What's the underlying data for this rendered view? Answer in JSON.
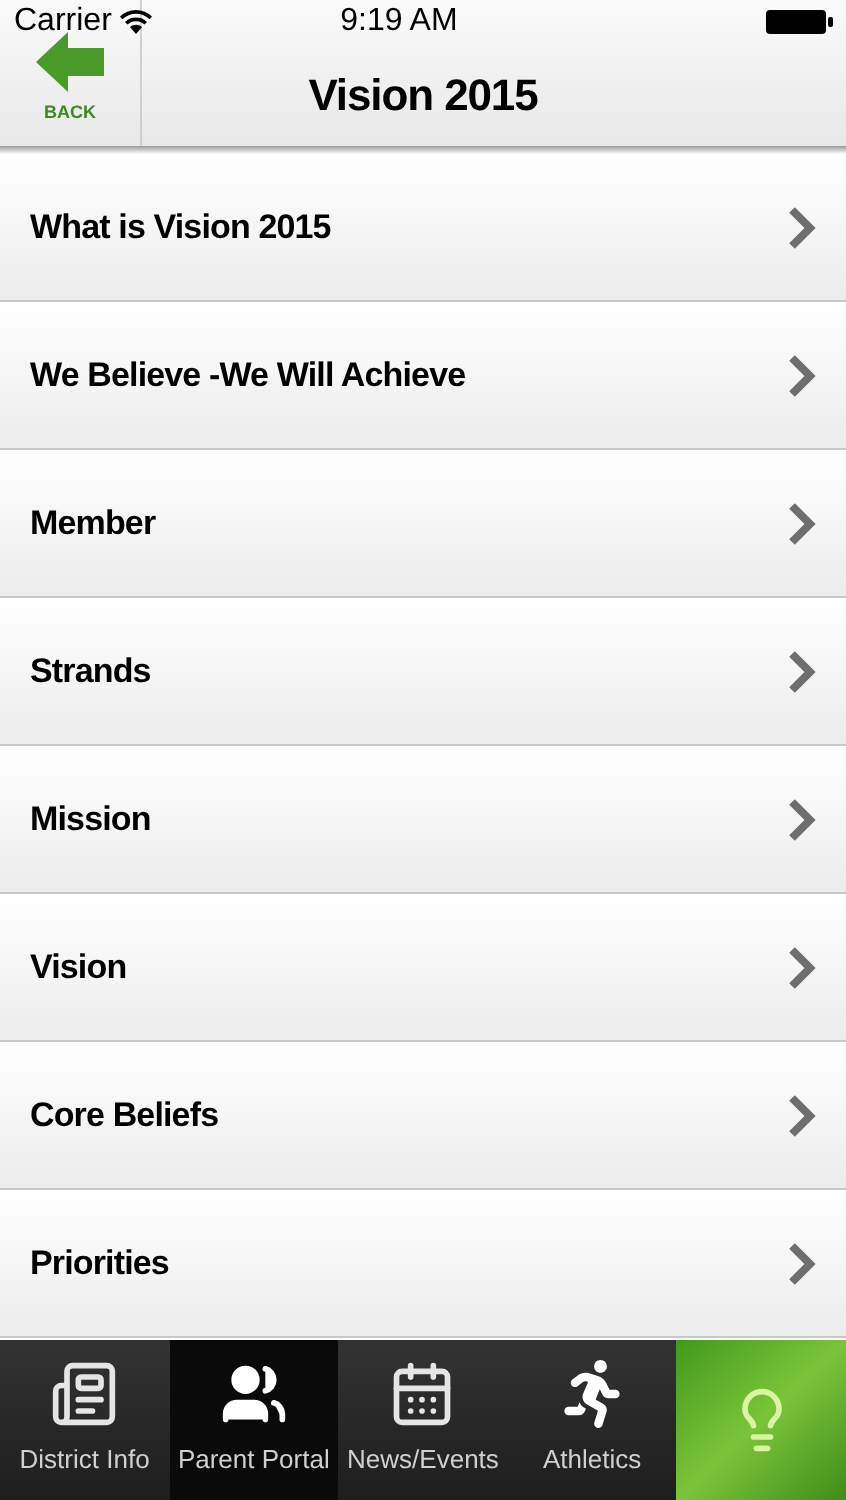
{
  "status_bar": {
    "carrier": "Carrier",
    "time": "9:19 AM"
  },
  "nav_bar": {
    "back_label": "BACK",
    "title": "Vision 2015"
  },
  "items": [
    {
      "label": "What is Vision 2015"
    },
    {
      "label": "We Believe -We Will Achieve"
    },
    {
      "label": "Member"
    },
    {
      "label": "Strands"
    },
    {
      "label": "Mission"
    },
    {
      "label": "Vision"
    },
    {
      "label": "Core Beliefs"
    },
    {
      "label": "Priorities"
    }
  ],
  "tabs": [
    {
      "kind": "news",
      "label": "District Info",
      "selected": false
    },
    {
      "kind": "people",
      "label": "Parent Portal",
      "selected": true
    },
    {
      "kind": "calendar",
      "label": "News/Events",
      "selected": false
    },
    {
      "kind": "runner",
      "label": "Athletics",
      "selected": false
    },
    {
      "kind": "bulb"
    }
  ]
}
